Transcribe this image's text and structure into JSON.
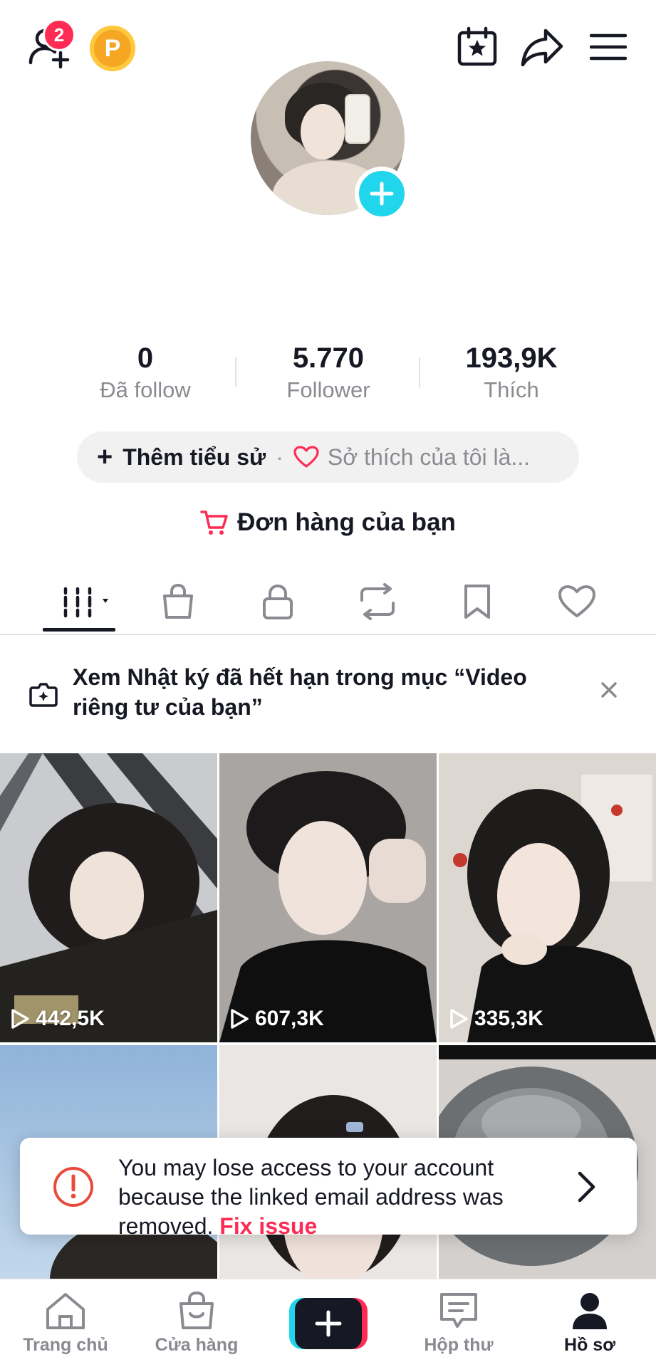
{
  "header": {
    "friend_badge": "2",
    "coin_label": "P"
  },
  "profile": {
    "stats": [
      {
        "value": "0",
        "label": "Đã follow"
      },
      {
        "value": "5.770",
        "label": "Follower"
      },
      {
        "value": "193,9K",
        "label": "Thích"
      }
    ],
    "bio_add_label": "Thêm tiểu sử",
    "bio_separator": "·",
    "bio_hint": "Sở thích của tôi là...",
    "orders_label": "Đơn hàng của bạn"
  },
  "notice": {
    "text": "Xem Nhật ký đã hết hạn trong mục “Video riêng tư của bạn”"
  },
  "videos": [
    {
      "views": "442,5K"
    },
    {
      "views": "607,3K"
    },
    {
      "views": "335,3K"
    },
    {
      "views": ""
    },
    {
      "views": ""
    },
    {
      "views": ""
    }
  ],
  "toast": {
    "message": "You may lose access to your account because the linked email address was removed.",
    "link_label": "Fix issue"
  },
  "bottom_nav": {
    "home": "Trang chủ",
    "shop": "Cửa hàng",
    "inbox": "Hộp thư",
    "profile": "Hồ sơ"
  },
  "colors": {
    "accent_red": "#fe2c55",
    "accent_cyan": "#20d5ec",
    "text_primary": "#161823",
    "text_secondary": "#8a8b91"
  }
}
